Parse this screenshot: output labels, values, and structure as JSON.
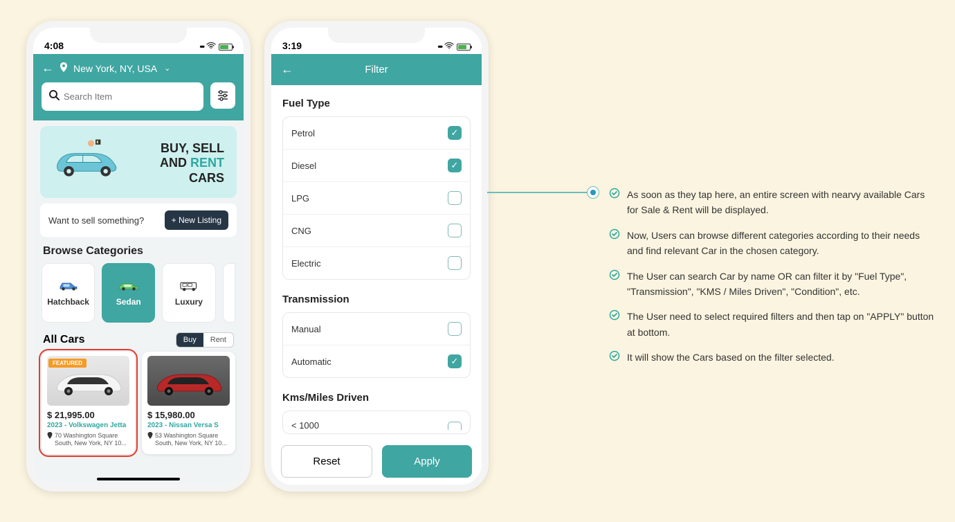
{
  "phone1": {
    "time": "4:08",
    "location": "New York, NY, USA",
    "search_placeholder": "Search Item",
    "banner_line1": "BUY, SELL",
    "banner_line2a": "AND ",
    "banner_line2b": "RENT",
    "banner_line3": "CARS",
    "sell_prompt": "Want to sell something?",
    "new_listing_btn": "+ New Listing",
    "browse_title": "Browse Categories",
    "categories": [
      {
        "label": "Hatchback",
        "active": false
      },
      {
        "label": "Sedan",
        "active": true
      },
      {
        "label": "Luxury",
        "active": false
      }
    ],
    "all_cars_title": "All Cars",
    "toggle_buy": "Buy",
    "toggle_rent": "Rent",
    "card1": {
      "badge": "FEATURED",
      "price": "$ 21,995.00",
      "meta": "2023 - Volkswagen Jetta",
      "addr": "70 Washington Square South, New York, NY 10..."
    },
    "card2": {
      "price": "$ 15,980.00",
      "meta": "2023 - Nissan Versa S",
      "addr": "53 Washington Square South, New York, NY 10..."
    }
  },
  "phone2": {
    "time": "3:19",
    "title": "Filter",
    "section_fuel": "Fuel Type",
    "fuel": [
      {
        "label": "Petrol",
        "checked": true
      },
      {
        "label": "Diesel",
        "checked": true
      },
      {
        "label": "LPG",
        "checked": false
      },
      {
        "label": "CNG",
        "checked": false
      },
      {
        "label": "Electric",
        "checked": false
      }
    ],
    "section_trans": "Transmission",
    "trans": [
      {
        "label": "Manual",
        "checked": false
      },
      {
        "label": "Automatic",
        "checked": true
      }
    ],
    "section_kms": "Kms/Miles Driven",
    "kms_first": "< 1000",
    "reset_btn": "Reset",
    "apply_btn": "Apply"
  },
  "notes": [
    "As soon as they tap here, an entire screen with nearvy available Cars for Sale & Rent will be displayed.",
    "Now, Users can browse different categories according to their needs and find relevant Car in the chosen category.",
    "The User can search Car by name OR can filter it by \"Fuel Type\", \"Transmission\", \"KMS / Miles Driven\", \"Condition\", etc.",
    "The User need to select required filters and then tap on \"APPLY\" button at bottom.",
    "It will show the Cars based on the filter selected."
  ]
}
